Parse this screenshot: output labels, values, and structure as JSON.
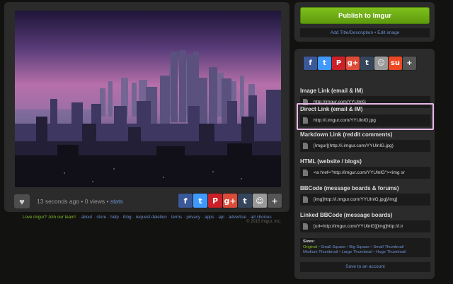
{
  "image": {
    "time_ago": "13 seconds ago",
    "separator": "•",
    "views": "0 views",
    "stats_label": "stats"
  },
  "social_small": [
    {
      "name": "facebook",
      "glyph": "f",
      "color": "#3b5998"
    },
    {
      "name": "twitter",
      "glyph": "t",
      "color": "#4099ff"
    },
    {
      "name": "pinterest",
      "glyph": "P",
      "color": "#cb2027"
    },
    {
      "name": "googleplus",
      "glyph": "g+",
      "color": "#dd4b39"
    },
    {
      "name": "tumblr",
      "glyph": "t",
      "color": "#35465c"
    },
    {
      "name": "reddit",
      "glyph": "☺",
      "color": "#999999"
    },
    {
      "name": "more",
      "glyph": "+",
      "color": "#555555"
    }
  ],
  "footer": {
    "love": "Love imgur? Join our team!",
    "links": [
      "about",
      "store",
      "help",
      "blog",
      "request deletion",
      "terms",
      "privacy",
      "apps",
      "api",
      "advertise",
      "ad choices"
    ],
    "copyright": "© 2015 Imgur, Inc."
  },
  "publish": {
    "button": "Publish to Imgur",
    "add_title": "Add Title/Description",
    "bullet": "•",
    "edit_image": "Edit image"
  },
  "share": [
    {
      "name": "facebook",
      "glyph": "f",
      "color": "#3b5998"
    },
    {
      "name": "twitter",
      "glyph": "t",
      "color": "#4099ff"
    },
    {
      "name": "pinterest",
      "glyph": "P",
      "color": "#cb2027"
    },
    {
      "name": "googleplus",
      "glyph": "g+",
      "color": "#dd4b39"
    },
    {
      "name": "tumblr",
      "glyph": "t",
      "color": "#35465c"
    },
    {
      "name": "reddit",
      "glyph": "☺",
      "color": "#999999"
    },
    {
      "name": "stumbleupon",
      "glyph": "su",
      "color": "#eb4924"
    },
    {
      "name": "more",
      "glyph": "+",
      "color": "#555555"
    }
  ],
  "links": [
    {
      "label": "Image Link (email & IM)",
      "value": "http://imgur.com/YYUlnlG"
    },
    {
      "label": "Direct Link (email & IM)",
      "value": "http://i.imgur.com/YYUlnlG.jpg"
    },
    {
      "label": "Markdown Link (reddit comments)",
      "value": "[Imgur](http://i.imgur.com/YYUlnlG.jpg)"
    },
    {
      "label": "HTML (website / blogs)",
      "value": "<a href=\"http://imgur.com/YYUlnlG\"><img sr"
    },
    {
      "label": "BBCode (message boards & forums)",
      "value": "[img]http://i.imgur.com/YYUlnlG.jpg[/img]"
    },
    {
      "label": "Linked BBCode (message boards)",
      "value": "[url=http://imgur.com/YYUlnlG][img]http://i.ir"
    }
  ],
  "sizes": {
    "label": "Sizes:",
    "original": "Original",
    "bullet": "•",
    "small_square": "Small Square",
    "big_square": "Big Square",
    "small_thumbnail": "Small Thumbnail",
    "medium_thumbnail": "Medium Thumbnail",
    "large_thumbnail": "Large Thumbnail",
    "huge_thumbnail": "Huge Thumbnail"
  },
  "save_account": "Save to an account"
}
